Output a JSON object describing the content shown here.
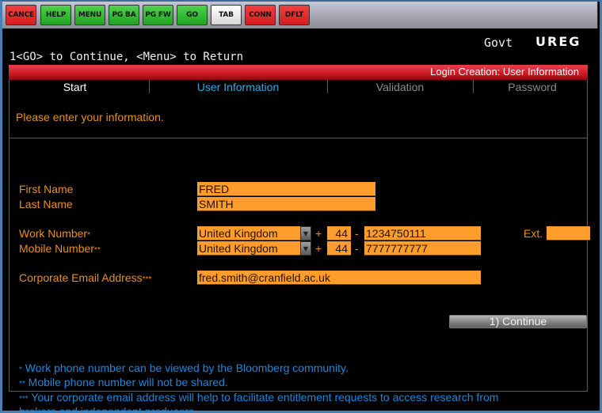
{
  "toolbar": {
    "buttons": [
      {
        "label": "CANCE",
        "color": "red"
      },
      {
        "label": "HELP",
        "color": "green"
      },
      {
        "label": "MENU",
        "color": "green"
      },
      {
        "label": "PG BA",
        "color": "green"
      },
      {
        "label": "PG FW",
        "color": "green"
      },
      {
        "label": "GO",
        "color": "green"
      },
      {
        "label": "TAB",
        "color": "white"
      },
      {
        "label": "CONN",
        "color": "red"
      },
      {
        "label": "DFLT",
        "color": "red"
      }
    ]
  },
  "header": {
    "sector": "Govt",
    "function_code": "UREG",
    "prompt": "1<GO> to Continue, <Menu> to Return",
    "title": "Login Creation: User Information"
  },
  "steps": [
    {
      "label": "Start",
      "state": "done",
      "color": "#ffffff"
    },
    {
      "label": "User Information",
      "state": "current",
      "color": "#33a7e0"
    },
    {
      "label": "Validation",
      "state": "pending",
      "color": "#8a8a8a"
    },
    {
      "label": "Password",
      "state": "pending",
      "color": "#8a8a8a"
    }
  ],
  "form": {
    "instruction": "Please enter your information.",
    "first_name": {
      "label": "First Name",
      "value": "FRED"
    },
    "last_name": {
      "label": "Last Name",
      "value": "SMITH"
    },
    "work_number": {
      "label": "Work Number",
      "marker": "*",
      "country": "United Kingdom",
      "plus": "+",
      "country_code": "44",
      "dash": "-",
      "number": "1234750111",
      "ext_label": "Ext.",
      "ext_value": ""
    },
    "mobile_number": {
      "label": "Mobile Number",
      "marker": "**",
      "country": "United Kingdom",
      "plus": "+",
      "country_code": "44",
      "dash": "-",
      "number": "7777777777"
    },
    "email": {
      "label": "Corporate Email Address",
      "marker": "***",
      "value": "fred.smith@cranfield.ac.uk"
    },
    "continue_label": "1) Continue"
  },
  "notes": [
    {
      "marker": "*",
      "text": " Work phone number can be viewed by the Bloomberg community."
    },
    {
      "marker": "**",
      "text": " Mobile phone number will not be shared."
    },
    {
      "marker": "***",
      "text": " Your corporate email address will help to facilitate entitlement requests to access research from"
    },
    {
      "marker": "",
      "text": "brokers and independent producers."
    }
  ],
  "colors": {
    "field_bg": "#ff9d2c",
    "label": "#e8901e",
    "note": "#1e86d8",
    "header_bar": "#c0151e"
  }
}
